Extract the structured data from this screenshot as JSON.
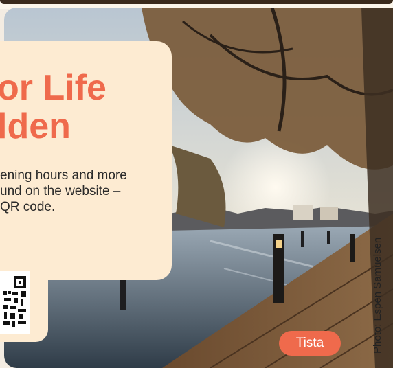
{
  "headline": {
    "line1": "or Life",
    "line2": "lden"
  },
  "info": {
    "line1": "ening hours and more",
    "line2": "und on the website –",
    "line3": "QR code."
  },
  "location_tag": "Tista",
  "photo_credit": "Photo: Espen Samuelsen",
  "colors": {
    "accent": "#ef6a4c",
    "card": "#fdebd2",
    "sky": "#c6d3df",
    "water": "#7e8fa0"
  },
  "photo_description_icon": "riverside-boardwalk-photo"
}
